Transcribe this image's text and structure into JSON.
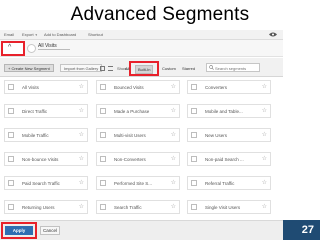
{
  "slide": {
    "title": "Advanced Segments",
    "page_number": "27"
  },
  "toolbar": {
    "items": [
      "Email",
      "Export",
      "Add to Dashboard",
      "Shortcut"
    ]
  },
  "segment_row": {
    "selected_segment": "All Visits"
  },
  "actions": {
    "new_segment": "+ Create New Segment",
    "import_gallery": "Import from Gallery",
    "show_label": "Show:",
    "filters": [
      "All",
      "Built-In",
      "Custom",
      "Starred"
    ],
    "active_filter": "Built-In",
    "search_placeholder": "Search segments"
  },
  "segments": [
    "All Visits",
    "Bounced Visits",
    "Converters",
    "Direct Traffic",
    "Made a Purchase",
    "Mobile and Table...",
    "Mobile Traffic",
    "Multi-visit Users",
    "New Users",
    "Non-bounce Visits",
    "Non-Converters",
    "Non-paid Search ...",
    "Paid Search Traffic",
    "Performed Site S...",
    "Referral Traffic",
    "Returning Users",
    "Search Traffic",
    "Single Visit Users"
  ],
  "bottom": {
    "apply": "Apply",
    "cancel": "Cancel"
  },
  "colors": {
    "highlight": "#e8212b",
    "apply_blue": "#2f6eb2",
    "slide_bar": "#1f4b73"
  }
}
